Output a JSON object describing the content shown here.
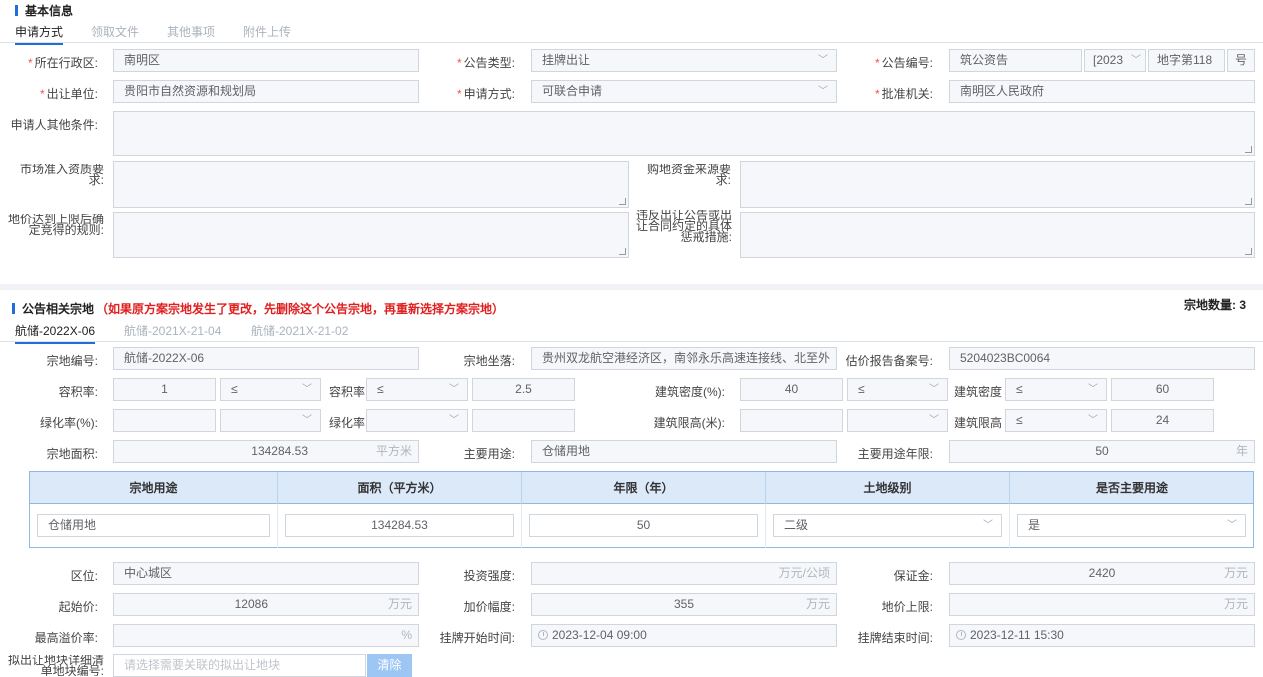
{
  "basic": {
    "section_title": "基本信息",
    "tabs": [
      "申请方式",
      "领取文件",
      "其他事项",
      "附件上传"
    ],
    "labels": {
      "district": "所在行政区:",
      "notice_type": "公告类型:",
      "notice_no": "公告编号:",
      "seller": "出让单位:",
      "apply_method": "申请方式:",
      "approver": "批准机关:",
      "other_conditions": "申请人其他条件:",
      "market_access": "市场准入资质要求:",
      "fund_source": "购地资金来源要求:",
      "price_limit_rule": "地价达到上限后确定竞得的规则:",
      "violation": "违反出让公告或出让合同约定的具体惩戒措施:"
    },
    "values": {
      "district": "南明区",
      "notice_type": "挂牌出让",
      "notice_prefix": "筑公资告",
      "notice_year": "[2023",
      "notice_middle": "地字第118",
      "notice_suffix": "号",
      "seller": "贵阳市自然资源和规划局",
      "apply_method": "可联合申请",
      "approver": "南明区人民政府"
    }
  },
  "parcel": {
    "section_title": "公告相关宗地",
    "warning": "（如果原方案宗地发生了更改，先删除这个公告宗地，再重新选择方案宗地）",
    "count_label": "宗地数量:",
    "count": "3",
    "tabs": [
      "航储-2022X-06",
      "航储-2021X-21-04",
      "航储-2021X-21-02"
    ],
    "labels": {
      "parcel_no": "宗地编号:",
      "location": "宗地坐落:",
      "appraisal_no": "估价报告备案号:",
      "far": "容积率:",
      "far2": "容积率",
      "density": "建筑密度(%):",
      "density2": "建筑密度",
      "green": "绿化率(%):",
      "green2": "绿化率",
      "height": "建筑限高(米):",
      "height2": "建筑限高",
      "area": "宗地面积:",
      "main_use": "主要用途:",
      "main_use_years": "主要用途年限:",
      "zone": "区位:",
      "invest": "投资强度:",
      "deposit": "保证金:",
      "start_price": "起始价:",
      "increment": "加价幅度:",
      "price_cap": "地价上限:",
      "max_premium": "最高溢价率:",
      "start_time": "挂牌开始时间:",
      "end_time": "挂牌结束时间:",
      "related": "拟出让地块详细清单地块编号:"
    },
    "values": {
      "parcel_no": "航储-2022X-06",
      "location": "贵州双龙航空港经济区，南邻永乐高速连接线、北至外",
      "appraisal_no": "5204023BC0064",
      "far_min": "1",
      "far_op1": "≤",
      "far_op2": "≤",
      "far_max": "2.5",
      "density_min": "40",
      "density_op1": "≤",
      "density_op2": "≤",
      "density_max": "60",
      "height_op2": "≤",
      "height_max": "24",
      "area": "134284.53",
      "area_unit": "平方米",
      "main_use": "仓储用地",
      "main_use_years": "50",
      "years_unit": "年",
      "zone": "中心城区",
      "invest_unit": "万元/公顷",
      "deposit": "2420",
      "wan_unit": "万元",
      "start_price": "12086",
      "increment": "355",
      "pct_unit": "%",
      "start_time": "2023-12-04 09:00",
      "end_time": "2023-12-11 15:30",
      "related_placeholder": "请选择需要关联的拟出让地块",
      "clear_button": "清除"
    },
    "table": {
      "headers": [
        "宗地用途",
        "面积（平方米）",
        "年限（年）",
        "土地级别",
        "是否主要用途"
      ],
      "row": [
        "仓储用地",
        "134284.53",
        "50",
        "二级",
        "是"
      ]
    }
  }
}
